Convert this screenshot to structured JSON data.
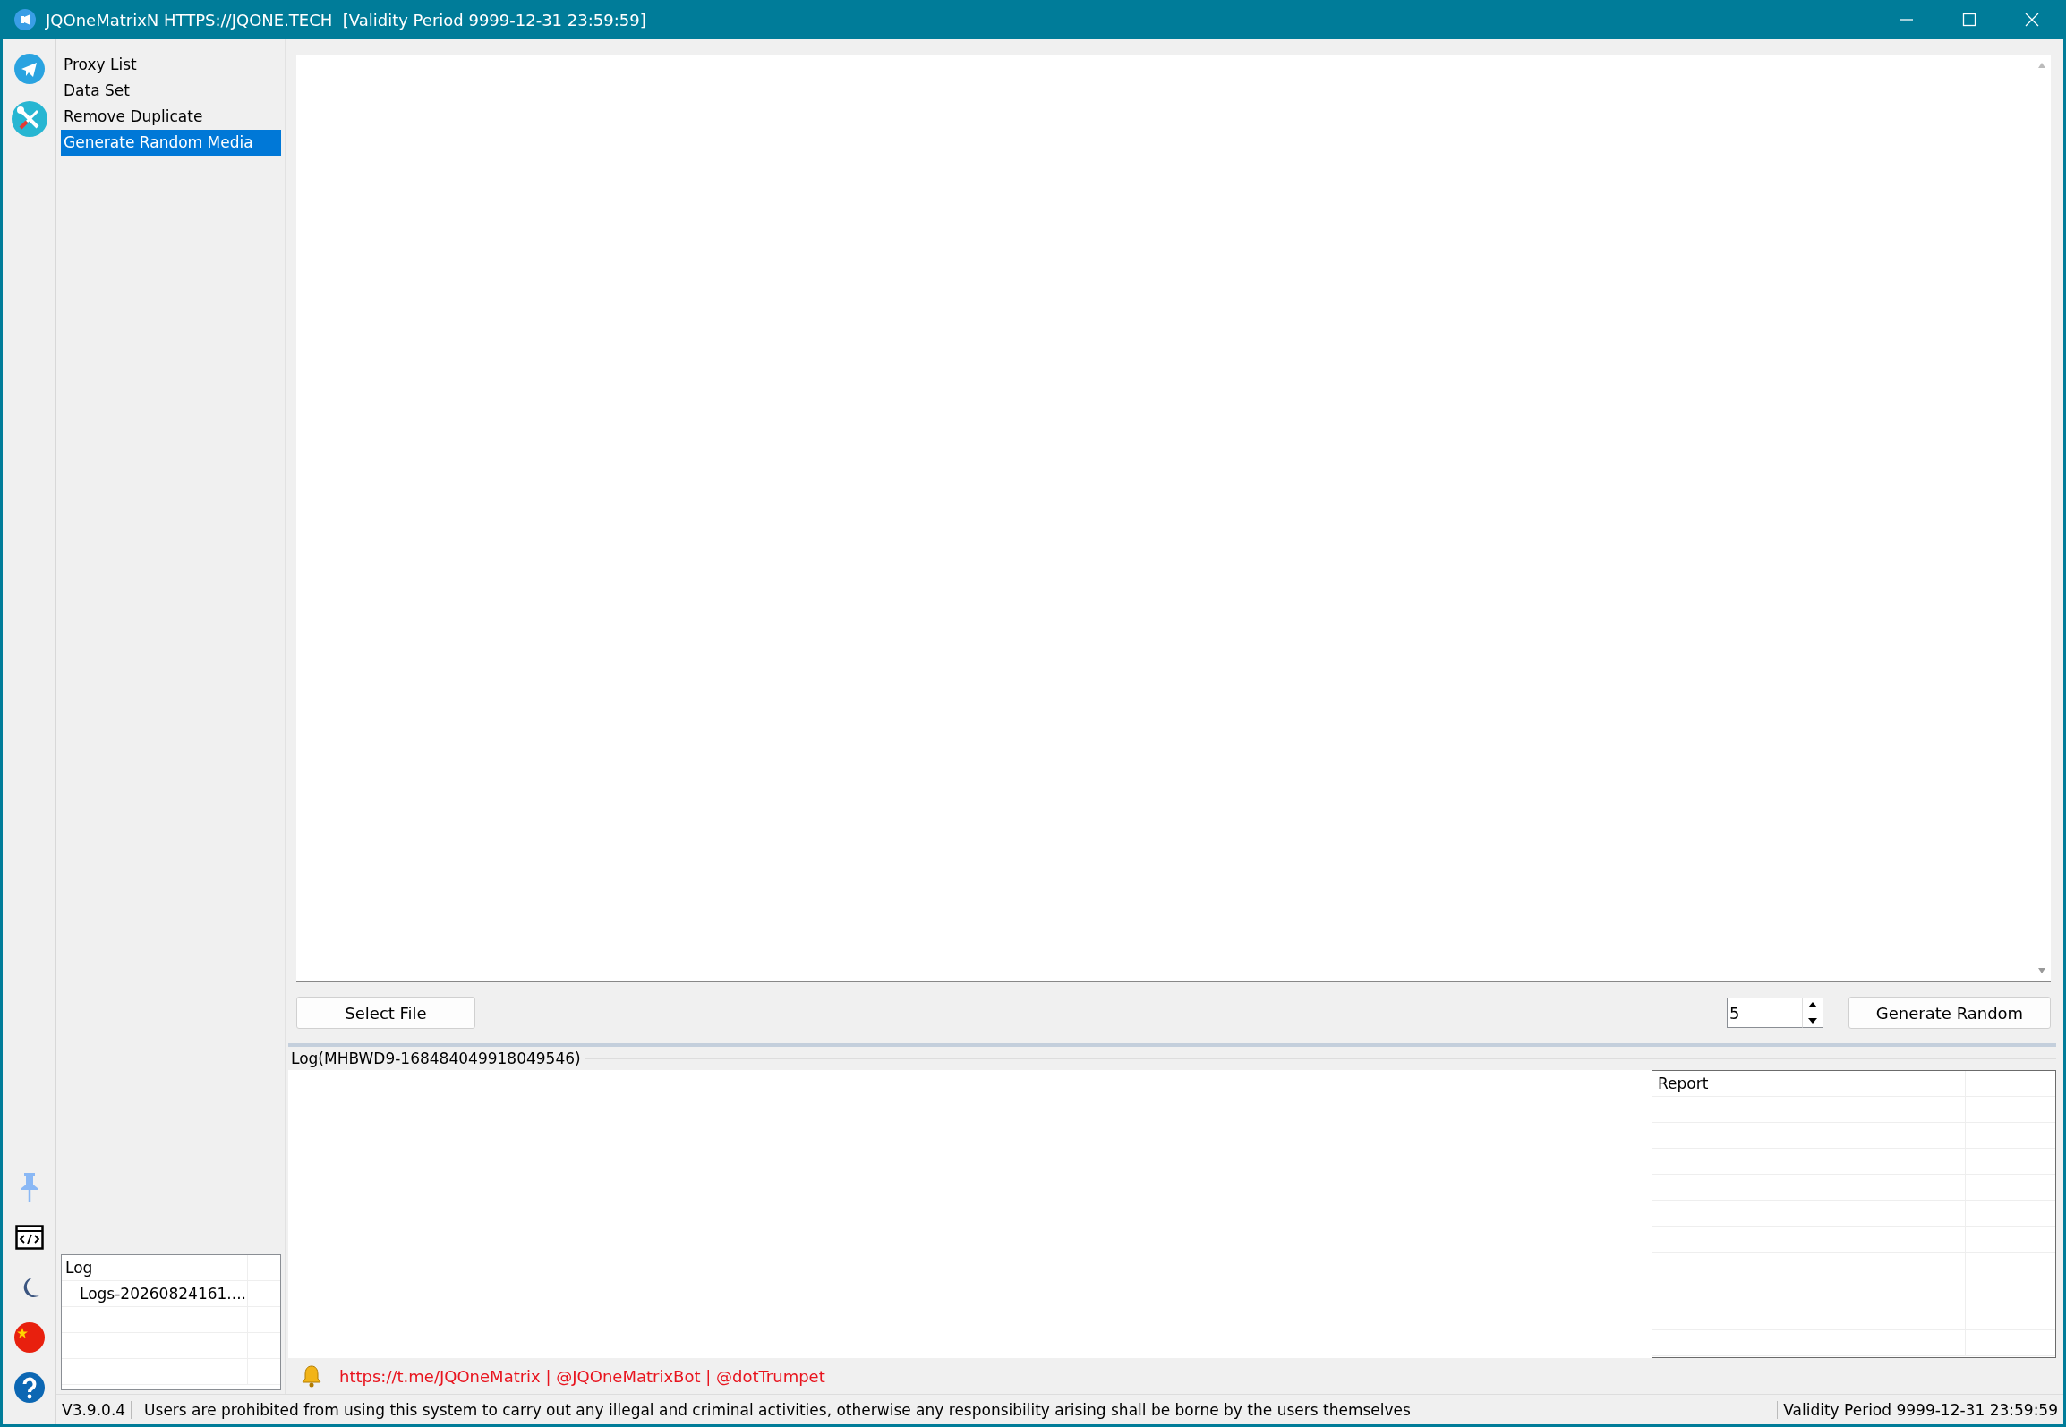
{
  "window": {
    "title": "JQOneMatrixN HTTPS://JQONE.TECH  [Validity Period 9999-12-31 23:59:59]"
  },
  "nav": {
    "items": [
      {
        "label": "Proxy List",
        "selected": false
      },
      {
        "label": "Data Set",
        "selected": false
      },
      {
        "label": "Remove Duplicate",
        "selected": false
      },
      {
        "label": "Generate Random Media",
        "selected": true
      }
    ]
  },
  "log_tree": {
    "header": "Log",
    "items": [
      {
        "label": "Logs-20260824161...."
      }
    ]
  },
  "controls": {
    "select_file": "Select File",
    "count": {
      "value": "5"
    },
    "generate": "Generate Random"
  },
  "log_panel": {
    "title": "Log(MHBWD9-168484049918049546)",
    "report_header": "Report"
  },
  "links": "https://t.me/JQOneMatrix | @JQOneMatrixBot | @dotTrumpet",
  "status_bar": {
    "version": "V3.9.0.4",
    "message": "Users are prohibited from using this system to carry out any illegal and criminal activities, otherwise any responsibility arising shall be borne by the users themselves",
    "validity": "Validity Period 9999-12-31 23:59:59"
  }
}
